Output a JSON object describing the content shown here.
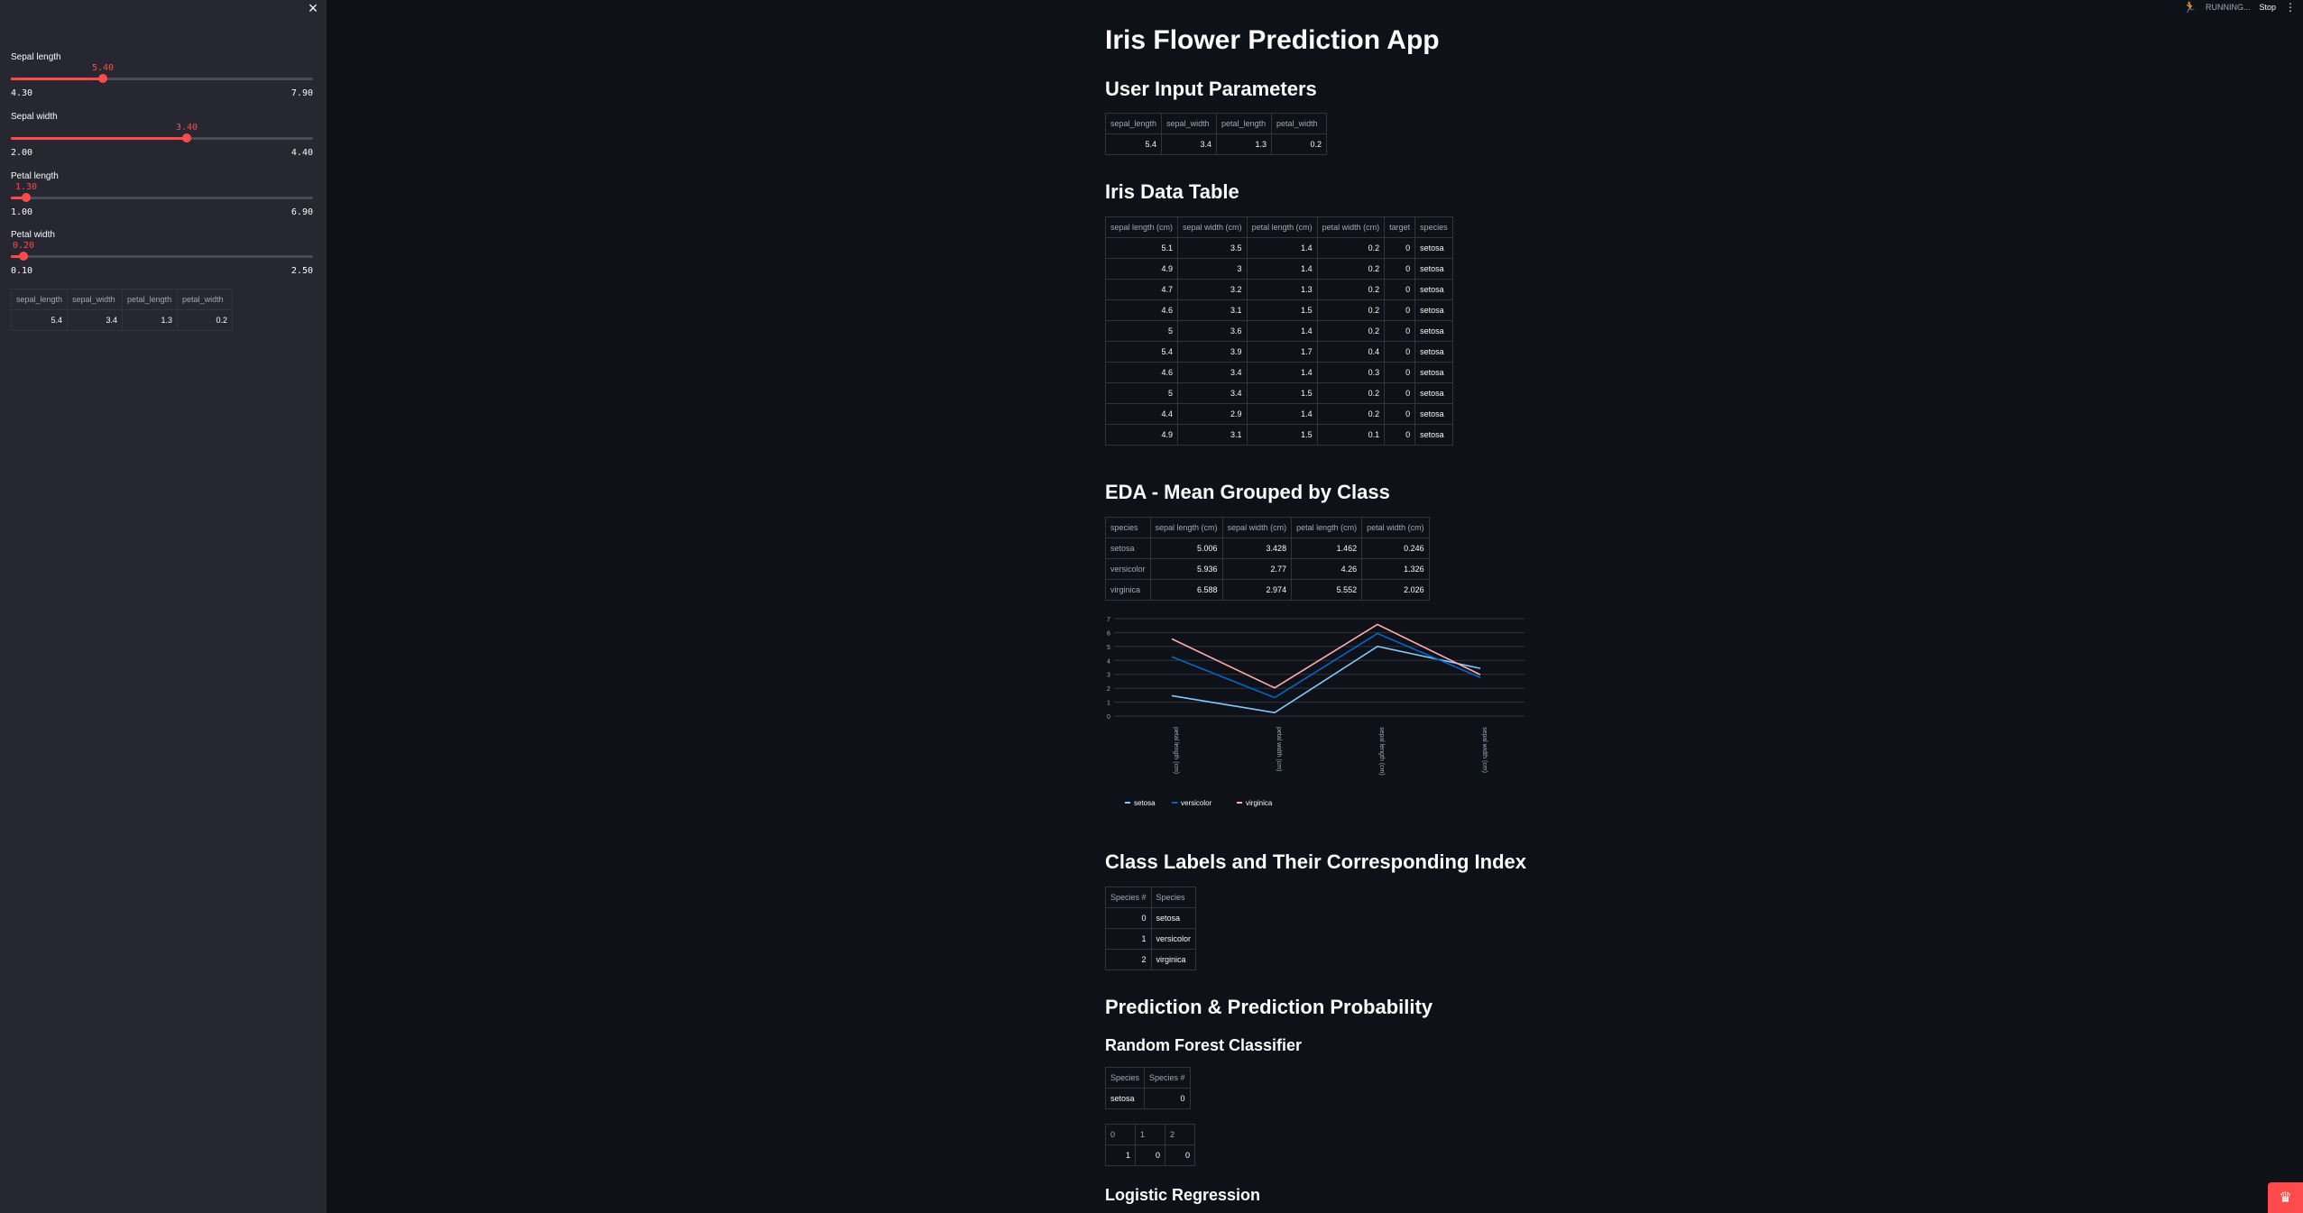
{
  "sidebar": {
    "close_icon": "close-icon",
    "sliders": [
      {
        "label": "Sepal length",
        "value": "5.40",
        "min": "4.30",
        "max": "7.90",
        "fraction": 0.306
      },
      {
        "label": "Sepal width",
        "value": "3.40",
        "min": "2.00",
        "max": "4.40",
        "fraction": 0.583
      },
      {
        "label": "Petal length",
        "value": "1.30",
        "min": "1.00",
        "max": "6.90",
        "fraction": 0.051
      },
      {
        "label": "Petal width",
        "value": "0.20",
        "min": "0.10",
        "max": "2.50",
        "fraction": 0.042
      }
    ],
    "table": {
      "headers": [
        "sepal_length",
        "sepal_width",
        "petal_length",
        "petal_width"
      ],
      "row": [
        "5.4",
        "3.4",
        "1.3",
        "0.2"
      ]
    }
  },
  "toolbar": {
    "status": "RUNNING...",
    "stop_label": "Stop",
    "menu": "⋮"
  },
  "main": {
    "title": "Iris Flower Prediction App",
    "user_input_heading": "User Input Parameters",
    "user_input_table": {
      "headers": [
        "sepal_length",
        "sepal_width",
        "petal_length",
        "petal_width"
      ],
      "row": [
        "5.4",
        "3.4",
        "1.3",
        "0.2"
      ]
    },
    "iris_heading": "Iris Data Table",
    "iris_table": {
      "headers": [
        "sepal length (cm)",
        "sepal width (cm)",
        "petal length (cm)",
        "petal width (cm)",
        "target",
        "species"
      ],
      "rows": [
        [
          "5.1",
          "3.5",
          "1.4",
          "0.2",
          "0",
          "setosa"
        ],
        [
          "4.9",
          "3",
          "1.4",
          "0.2",
          "0",
          "setosa"
        ],
        [
          "4.7",
          "3.2",
          "1.3",
          "0.2",
          "0",
          "setosa"
        ],
        [
          "4.6",
          "3.1",
          "1.5",
          "0.2",
          "0",
          "setosa"
        ],
        [
          "5",
          "3.6",
          "1.4",
          "0.2",
          "0",
          "setosa"
        ],
        [
          "5.4",
          "3.9",
          "1.7",
          "0.4",
          "0",
          "setosa"
        ],
        [
          "4.6",
          "3.4",
          "1.4",
          "0.3",
          "0",
          "setosa"
        ],
        [
          "5",
          "3.4",
          "1.5",
          "0.2",
          "0",
          "setosa"
        ],
        [
          "4.4",
          "2.9",
          "1.4",
          "0.2",
          "0",
          "setosa"
        ],
        [
          "4.9",
          "3.1",
          "1.5",
          "0.1",
          "0",
          "setosa"
        ]
      ]
    },
    "eda_heading": "EDA - Mean Grouped by Class",
    "eda_table": {
      "headers": [
        "species",
        "sepal length (cm)",
        "sepal width (cm)",
        "petal length (cm)",
        "petal width (cm)"
      ],
      "rows": [
        [
          "setosa",
          "5.006",
          "3.428",
          "1.462",
          "0.246"
        ],
        [
          "versicolor",
          "5.936",
          "2.77",
          "4.26",
          "1.326"
        ],
        [
          "virginica",
          "6.588",
          "2.974",
          "5.552",
          "2.026"
        ]
      ]
    },
    "class_heading": "Class Labels and Their Corresponding Index",
    "class_table": {
      "headers": [
        "Species #",
        "Species"
      ],
      "rows": [
        [
          "0",
          "setosa"
        ],
        [
          "1",
          "versicolor"
        ],
        [
          "2",
          "virginica"
        ]
      ]
    },
    "prediction_heading": "Prediction & Prediction Probability",
    "rf_heading": "Random Forest Classifier",
    "rf_pred_table": {
      "headers": [
        "Species",
        "Species #"
      ],
      "row": [
        "setosa",
        "0"
      ]
    },
    "rf_proba_table": {
      "headers": [
        "0",
        "1",
        "2"
      ],
      "row": [
        "1",
        "0",
        "0"
      ]
    },
    "lr_heading": "Logistic Regression"
  },
  "chart_data": {
    "type": "line",
    "categories": [
      "petal length (cm)",
      "petal width (cm)",
      "sepal length (cm)",
      "sepal width (cm)"
    ],
    "series": [
      {
        "name": "setosa",
        "color": "#83c9ff",
        "values": [
          1.462,
          0.246,
          5.006,
          3.428
        ]
      },
      {
        "name": "versicolor",
        "color": "#0068c9",
        "values": [
          4.26,
          1.326,
          5.936,
          2.77
        ]
      },
      {
        "name": "virginica",
        "color": "#ffabab",
        "values": [
          5.552,
          2.026,
          6.588,
          2.974
        ]
      }
    ],
    "yticks": [
      "0",
      "1",
      "2",
      "3",
      "4",
      "5",
      "6",
      "7"
    ],
    "ylim": [
      0,
      7
    ],
    "legend_position": "bottom-left",
    "grid": true
  }
}
